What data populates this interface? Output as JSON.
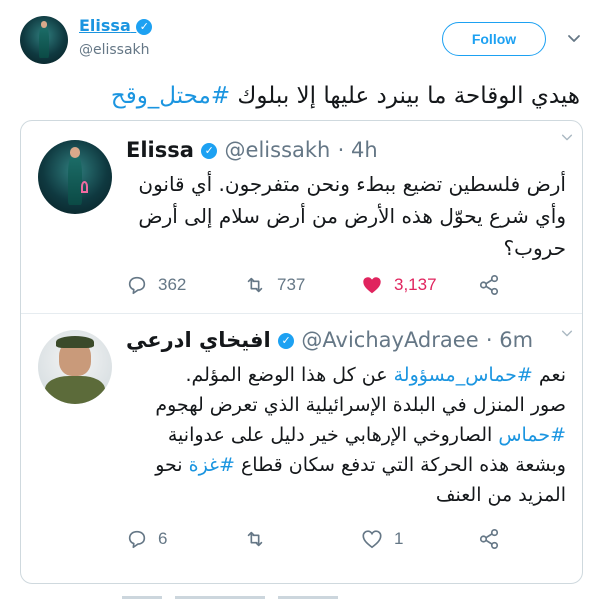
{
  "main": {
    "name": "Elissa",
    "handle": "@elissakh",
    "follow_label": "Follow",
    "text_plain": "هيدي الوقاحة ما بينرد عليها إلا ببلوك ",
    "text_hashtag": "#محتل_وقح"
  },
  "quote1": {
    "name": "Elissa",
    "handle": "@elissakh",
    "time": "· 4h",
    "line1": "أرض فلسطين تضيع ببطء ونحن متفرجون. أي قانون",
    "line2": "وأي شرع يحوّل هذه الأرض من أرض سلام إلى أرض",
    "line3": "حروب؟",
    "replies": "362",
    "retweets": "737",
    "likes": "3,137"
  },
  "quote2": {
    "name": "افيخاي ادرعي",
    "handle": "@AvichayAdraee",
    "time": "· 6m",
    "line1_pre": "نعم ",
    "line1_tag": "#حماس_مسؤولة",
    "line1_post": " عن كل هذا الوضع المؤلم.",
    "line2": "صور المنزل في البلدة الإسرائيلية الذي تعرض لهجوم",
    "line3_tag": "#حماس",
    "line3_post": " الصاروخي الإرهابي خير دليل على عدوانية",
    "line4_pre": "وبشعة هذه الحركة التي تدفع سكان قطاع ",
    "line4_tag": "#غزة",
    "line4_post": " نحو",
    "line5": "المزيد من العنف",
    "replies": "6",
    "likes": "1"
  },
  "icons": [
    "verified-badge-icon",
    "chevron-down-icon",
    "reply-icon",
    "retweet-icon",
    "like-icon",
    "share-icon"
  ],
  "colors": {
    "accent": "#1da1f2",
    "like": "#e0245e",
    "muted": "#657786",
    "hashtag": "#1b95e0"
  }
}
